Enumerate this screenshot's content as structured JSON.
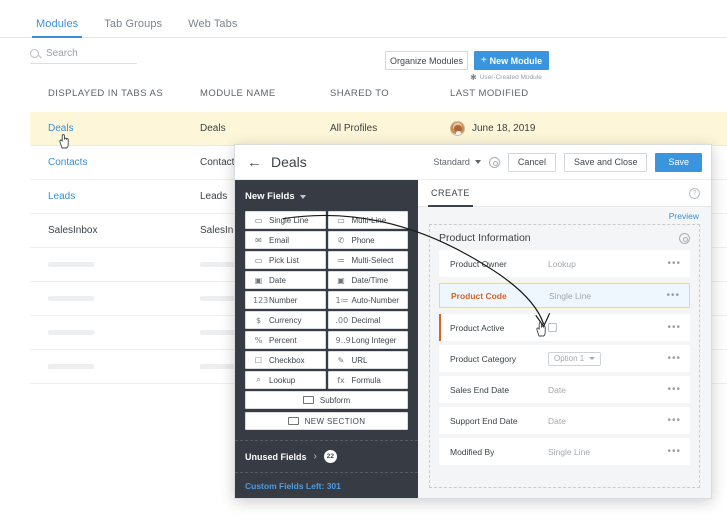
{
  "tabs": [
    {
      "label": "Modules",
      "active": true
    },
    {
      "label": "Tab Groups",
      "active": false
    },
    {
      "label": "Web Tabs",
      "active": false
    }
  ],
  "search": {
    "placeholder": "Search",
    "value": "",
    "icon": "search-icon"
  },
  "toolbar": {
    "organize_label": "Organize Modules",
    "new_module_label": "New Module",
    "new_module_plus": "+",
    "legend_star": "✱",
    "legend_text": "User-Created Module",
    "accent_color": "#3a95de"
  },
  "table": {
    "columns": [
      "DISPLAYED IN TABS AS",
      "MODULE NAME",
      "SHARED TO",
      "LAST MODIFIED"
    ],
    "rows": [
      {
        "displayed": "Deals",
        "module": "Deals",
        "shared": "All Profiles",
        "modified": "June 18, 2019",
        "highlight": true,
        "link": true,
        "avatar": true
      },
      {
        "displayed": "Contacts",
        "module": "Contacts",
        "shared": "",
        "modified": "",
        "highlight": false,
        "link": true,
        "avatar": false
      },
      {
        "displayed": "Leads",
        "module": "Leads",
        "shared": "",
        "modified": "",
        "highlight": false,
        "link": true,
        "avatar": false
      },
      {
        "displayed": "SalesInbox",
        "module": "SalesInbox",
        "shared": "",
        "modified": "",
        "highlight": false,
        "link": false,
        "avatar": false
      }
    ],
    "skeleton_row_count": 4,
    "highlight_color": "#fdf6d8"
  },
  "modal": {
    "back_icon": "back-arrow-icon",
    "title": "Deals",
    "layout_select": {
      "value": "Standard",
      "icon": "chevron-down-icon"
    },
    "settings_icon": "gear-icon",
    "buttons": {
      "cancel": "Cancel",
      "save_and_close": "Save and Close",
      "save": "Save"
    },
    "palette": {
      "title": "New Fields",
      "collapse_icon": "chevron-down-icon",
      "fields": [
        {
          "label": "Single Line",
          "glyph": "▭",
          "icon": "single-line-icon"
        },
        {
          "label": "Multi-Line",
          "glyph": "▭",
          "icon": "multi-line-icon"
        },
        {
          "label": "Email",
          "glyph": "✉",
          "icon": "email-icon"
        },
        {
          "label": "Phone",
          "glyph": "✆",
          "icon": "phone-icon"
        },
        {
          "label": "Pick List",
          "glyph": "▭",
          "icon": "pick-list-icon"
        },
        {
          "label": "Multi-Select",
          "glyph": "≔",
          "icon": "multi-select-icon"
        },
        {
          "label": "Date",
          "glyph": "▣",
          "icon": "date-icon"
        },
        {
          "label": "Date/Time",
          "glyph": "▣",
          "icon": "date-time-icon"
        },
        {
          "label": "Number",
          "glyph": "123",
          "icon": "number-icon"
        },
        {
          "label": "Auto-Number",
          "glyph": "1≔",
          "icon": "auto-number-icon"
        },
        {
          "label": "Currency",
          "glyph": "$",
          "icon": "currency-icon"
        },
        {
          "label": "Decimal",
          "glyph": ".00",
          "icon": "decimal-icon"
        },
        {
          "label": "Percent",
          "glyph": "%",
          "icon": "percent-icon"
        },
        {
          "label": "Long Integer",
          "glyph": "9..9",
          "icon": "long-integer-icon"
        },
        {
          "label": "Checkbox",
          "glyph": "☐",
          "icon": "checkbox-icon"
        },
        {
          "label": "URL",
          "glyph": "✎",
          "icon": "url-icon"
        },
        {
          "label": "Lookup",
          "glyph": "⌕",
          "icon": "lookup-icon"
        },
        {
          "label": "Formula",
          "glyph": "fx",
          "icon": "formula-icon"
        }
      ],
      "subform_label": "Subform",
      "new_section_label": "NEW SECTION",
      "unused_fields_label": "Unused Fields",
      "unused_fields_count": "22",
      "custom_fields_left": "Custom Fields Left: 301",
      "background_color": "#373c44"
    },
    "canvas": {
      "tab_label": "CREATE",
      "help_icon": "help-icon",
      "preview_label": "Preview",
      "section": {
        "title": "Product Information",
        "settings_icon": "gear-icon",
        "rows": [
          {
            "name": "Product Owner",
            "value": "Lookup",
            "control": "text",
            "state": "normal"
          },
          {
            "name": "Product Code",
            "value": "Single Line",
            "control": "text",
            "state": "dragging"
          },
          {
            "name": "Product Active",
            "value": "",
            "control": "checkbox",
            "state": "marked"
          },
          {
            "name": "Product Category",
            "value": "Option 1",
            "control": "select",
            "state": "normal"
          },
          {
            "name": "Sales End Date",
            "value": "Date",
            "control": "text",
            "state": "normal"
          },
          {
            "name": "Support End Date",
            "value": "Date",
            "control": "text",
            "state": "normal"
          },
          {
            "name": "Modified By",
            "value": "Single Line",
            "control": "text",
            "state": "normal"
          }
        ],
        "row_menu_icon": "more-options-icon"
      }
    }
  },
  "annotation": {
    "drag_arrow": "curved arrow from Single Line field type to Product Code row",
    "cursor_table": "hand-cursor",
    "cursor_drop": "hand-cursor"
  }
}
